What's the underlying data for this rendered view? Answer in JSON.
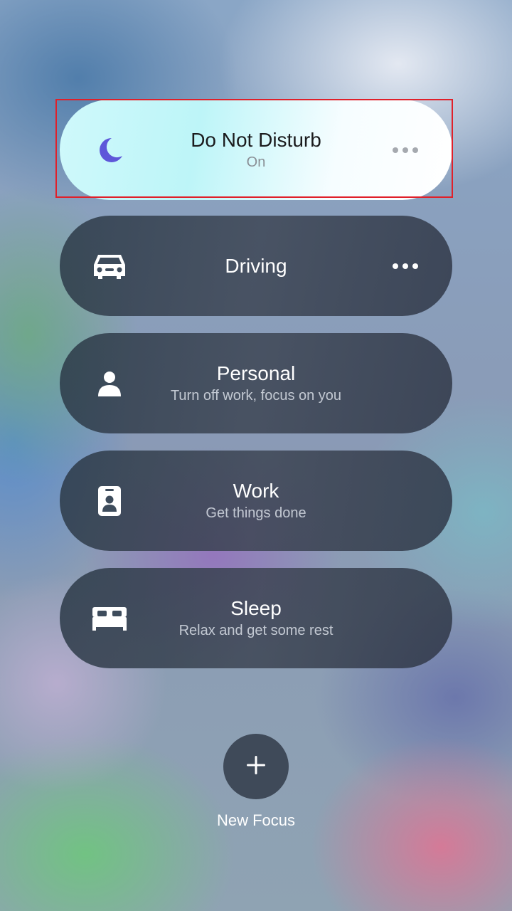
{
  "focus_modes": [
    {
      "title": "Do Not Disturb",
      "subtitle": "On",
      "icon": "moon-icon",
      "active": true
    },
    {
      "title": "Driving",
      "subtitle": "",
      "icon": "car-icon",
      "active": false
    },
    {
      "title": "Personal",
      "subtitle": "Turn off work, focus on you",
      "icon": "person-icon",
      "active": false
    },
    {
      "title": "Work",
      "subtitle": "Get things done",
      "icon": "id-badge-icon",
      "active": false
    },
    {
      "title": "Sleep",
      "subtitle": "Relax and get some rest",
      "icon": "bed-icon",
      "active": false
    }
  ],
  "new_focus": {
    "label": "New Focus",
    "icon": "plus-icon"
  },
  "colors": {
    "moon": "#5e57d9",
    "highlight_border": "#e0202a",
    "active_card_start": "#bdf5f8"
  }
}
